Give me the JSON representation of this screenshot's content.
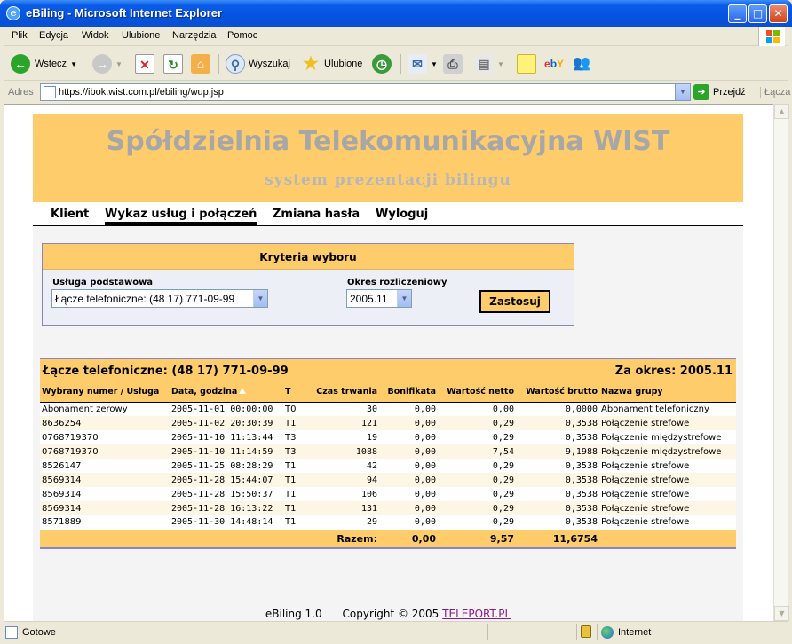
{
  "window": {
    "title": "eBiling - Microsoft Internet Explorer"
  },
  "menu": [
    "Plik",
    "Edycja",
    "Widok",
    "Ulubione",
    "Narzędzia",
    "Pomoc"
  ],
  "toolbar": {
    "back": "Wstecz",
    "search": "Wyszukaj",
    "favorites": "Ulubione"
  },
  "address": {
    "label": "Adres",
    "url": "https://ibok.wist.com.pl/ebiling/wup.jsp",
    "go": "Przejdź",
    "links": "Łącza"
  },
  "header": {
    "title": "Spółdzielnia Telekomunikacyjna WIST",
    "subtitle": "system prezentacji bilingu"
  },
  "nav": [
    "Klient",
    "Wykaz usług i połączeń",
    "Zmiana hasła",
    "Wyloguj"
  ],
  "criteria": {
    "title": "Kryteria wyboru",
    "service_label": "Usługa podstawowa",
    "service_value": "Łącze telefoniczne: (48 17) 771-09-99",
    "period_label": "Okres rozliczeniowy",
    "period_value": "2005.11",
    "apply": "Zastosuj"
  },
  "results": {
    "service": "Łącze telefoniczne: (48 17) 771-09-99",
    "period": "Za okres: 2005.11",
    "columns": [
      "Wybrany numer / Usługa",
      "Data, godzina",
      "T",
      "Czas trwania",
      "Bonifikata",
      "Wartość netto",
      "Wartość brutto",
      "Nazwa grupy"
    ],
    "rows": [
      [
        "Abonament zerowy",
        "2005-11-01 00:00:00",
        "T0",
        "30",
        "0,00",
        "0,00",
        "0,0000",
        "Abonament telefoniczny"
      ],
      [
        "8636254",
        "2005-11-02 20:30:39",
        "T1",
        "121",
        "0,00",
        "0,29",
        "0,3538",
        "Połączenie strefowe"
      ],
      [
        "0768719370",
        "2005-11-10 11:13:44",
        "T3",
        "19",
        "0,00",
        "0,29",
        "0,3538",
        "Połączenie międzystrefowe"
      ],
      [
        "0768719370",
        "2005-11-10 11:14:59",
        "T3",
        "1088",
        "0,00",
        "7,54",
        "9,1988",
        "Połączenie międzystrefowe"
      ],
      [
        "8526147",
        "2005-11-25 08:28:29",
        "T1",
        "42",
        "0,00",
        "0,29",
        "0,3538",
        "Połączenie strefowe"
      ],
      [
        "8569314",
        "2005-11-28 15:44:07",
        "T1",
        "94",
        "0,00",
        "0,29",
        "0,3538",
        "Połączenie strefowe"
      ],
      [
        "8569314",
        "2005-11-28 15:50:37",
        "T1",
        "106",
        "0,00",
        "0,29",
        "0,3538",
        "Połączenie strefowe"
      ],
      [
        "8569314",
        "2005-11-28 16:13:22",
        "T1",
        "131",
        "0,00",
        "0,29",
        "0,3538",
        "Połączenie strefowe"
      ],
      [
        "8571889",
        "2005-11-30 14:48:14",
        "T1",
        "29",
        "0,00",
        "0,29",
        "0,3538",
        "Połączenie strefowe"
      ]
    ],
    "totals": {
      "label": "Razem:",
      "bonus": "0,00",
      "net": "9,57",
      "gross": "11,6754"
    }
  },
  "footer": {
    "app": "eBiling 1.0",
    "copyright": "Copyright © 2005",
    "link": "TELEPORT.PL"
  },
  "status": {
    "text": "Gotowe",
    "zone": "Internet"
  },
  "colors": {
    "accent": "#fecc6b",
    "border": "#8c82c6",
    "title_blue": "#0554e0"
  }
}
